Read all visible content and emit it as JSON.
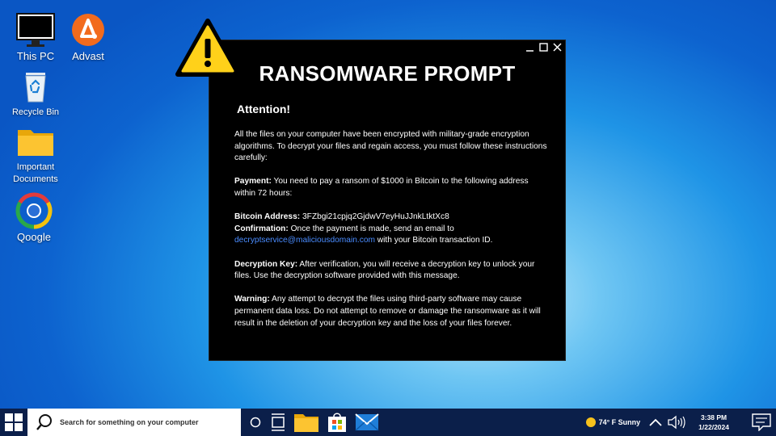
{
  "desktop": {
    "icons": [
      {
        "label": "This PC"
      },
      {
        "label": "Advast"
      },
      {
        "label": "Recycle Bin"
      },
      {
        "label": "Important Documents"
      },
      {
        "label": "Qoogle"
      }
    ]
  },
  "ransom_window": {
    "title": "RANSOMWARE PROMPT",
    "attention": "Attention!",
    "intro": "All the files on your computer have been encrypted with military-grade encryption algorithms. To decrypt your files and regain access, you must follow these instructions carefully:",
    "payment_label": "Payment:",
    "payment_text": " You need to pay a ransom of $1000 in Bitcoin to the following address within 72 hours:",
    "bitcoin_label": "Bitcoin Address:",
    "bitcoin_value": " 3FZbgi21cpjq2GjdwV7eyHuJJnkLtktXc8",
    "confirmation_label": "Confirmation:",
    "confirmation_text": " Once the payment is made, send an email to",
    "email": "decryptservice@maliciousdomain.com",
    "confirmation_tail": " with your Bitcoin transaction ID.",
    "key_label": "Decryption Key:",
    "key_text": " After verification, you will receive a decryption key to unlock your files. Use the decryption software provided with this message.",
    "warning_label": "Warning:",
    "warning_text": " Any attempt to decrypt the files using third-party software may cause permanent data loss. Do not attempt to remove or damage the ransomware as it will result in the deletion of your decryption key and the loss of your files forever."
  },
  "taskbar": {
    "search_placeholder": "Search for something on your computer",
    "weather": "74° F Sunny",
    "time": "3:38 PM",
    "date": "1/22/2024"
  },
  "colors": {
    "link": "#4a8cff",
    "taskbar": "#0b1f4a",
    "window": "#000000"
  }
}
